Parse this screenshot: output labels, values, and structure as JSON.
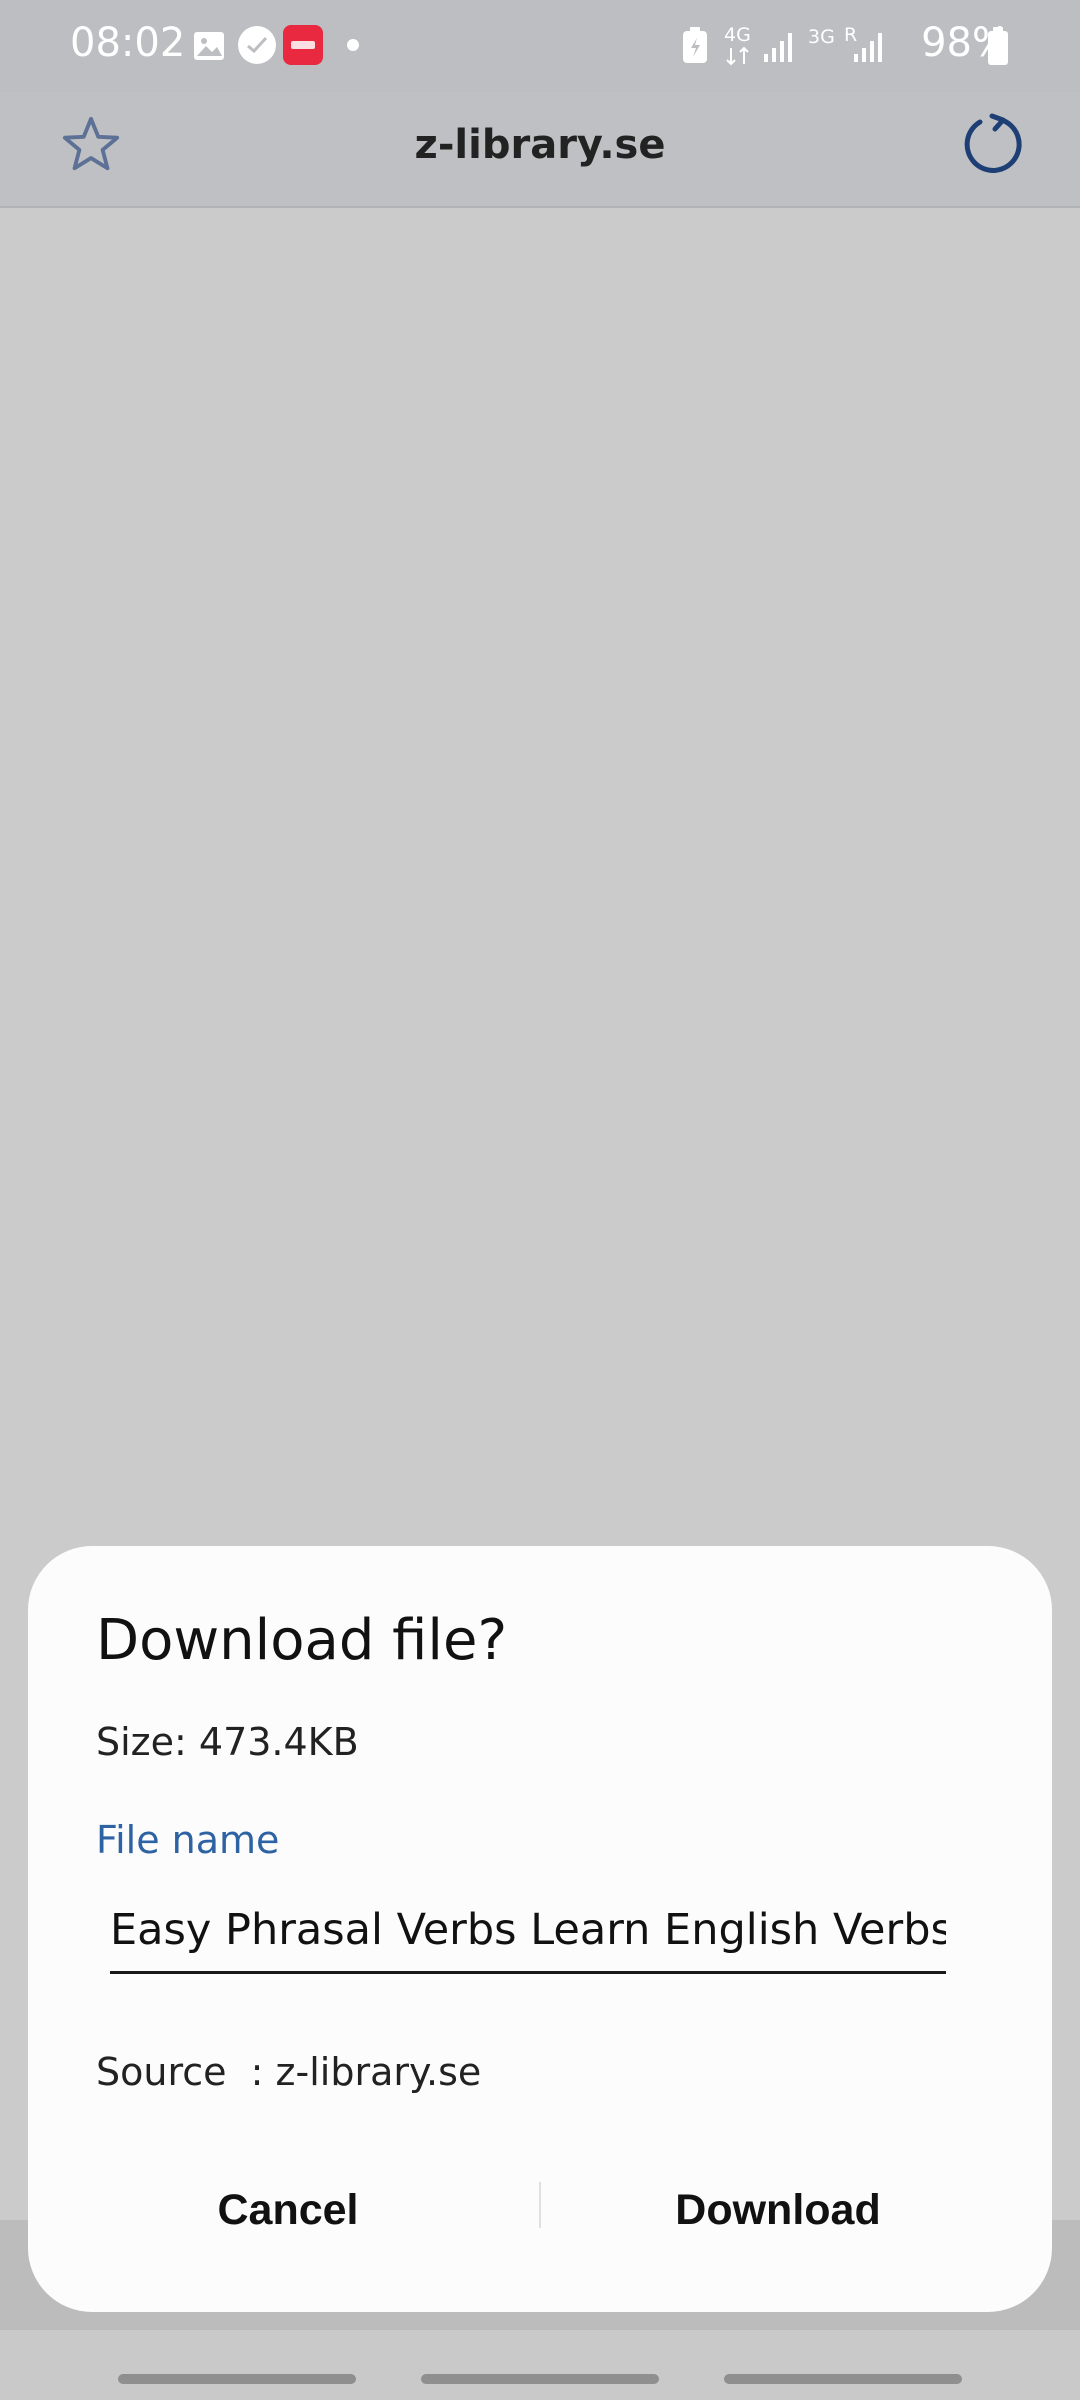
{
  "status_bar": {
    "time": "08:02",
    "network_1": "4G",
    "network_2": "3G",
    "roaming": "R",
    "battery": "98%",
    "icons": [
      "gallery-icon",
      "chat-app-icon",
      "xiaohongshu-icon",
      "dot-icon",
      "battery-saver-icon",
      "signal-icon",
      "signal-icon",
      "battery-icon"
    ]
  },
  "toolbar": {
    "url": "z-library.se",
    "star_icon": "star-icon",
    "reload_icon": "reload-icon"
  },
  "dialog": {
    "title": "Download file?",
    "size": "Size: 473.4KB",
    "file_name_label": "File name",
    "file_name_value": "Easy Phrasal Verbs Learn English Verbs T",
    "source": "Source  : z-library.se",
    "cancel_label": "Cancel",
    "download_label": "Download"
  },
  "colors": {
    "accent_blue": "#2d62a3",
    "scrim": "#cbcbcb",
    "dialog_bg": "#fcfcfc"
  }
}
